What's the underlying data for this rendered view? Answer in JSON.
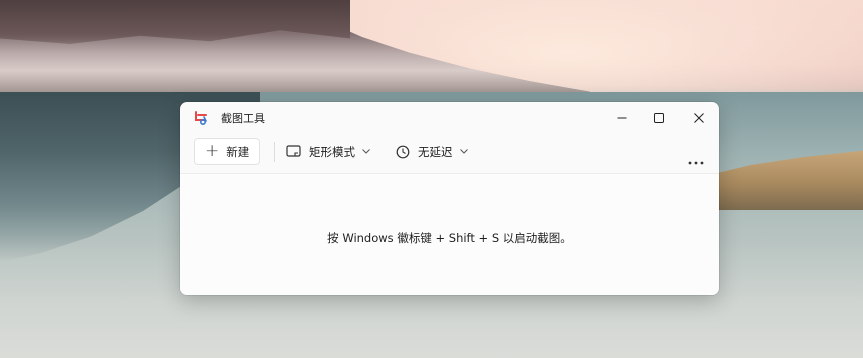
{
  "window": {
    "title": "截图工具",
    "controls": {
      "minimize_icon": "minimize-icon",
      "maximize_icon": "maximize-icon",
      "close_icon": "close-icon"
    }
  },
  "toolbar": {
    "new_label": "新建",
    "mode_label": "矩形模式",
    "delay_label": "无延迟",
    "more_icon": "more-horizontal-icon"
  },
  "body": {
    "hint": "按 Windows 徽标键 + Shift + S 以启动截图。"
  },
  "colors": {
    "window_bg": "#fafafa",
    "text": "#1f1f1f",
    "app_icon_red": "#e8484b",
    "app_icon_blue": "#3a7bd5"
  }
}
